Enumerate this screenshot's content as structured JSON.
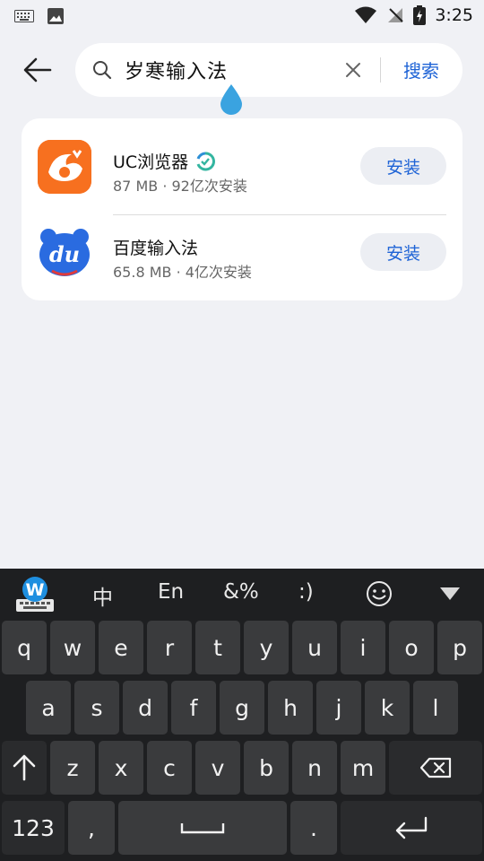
{
  "status": {
    "time": "3:25"
  },
  "search": {
    "query": "岁寒输入法",
    "button": "搜索"
  },
  "apps": [
    {
      "name": "UC浏览器",
      "meta": "87 MB · 92亿次安装",
      "action": "安装",
      "icon": "uc-browser-icon",
      "badge": "verified-badge-icon"
    },
    {
      "name": "百度输入法",
      "meta": "65.8 MB · 4亿次安装",
      "action": "安装",
      "icon": "baidu-ime-icon"
    }
  ],
  "keyboard": {
    "toolbar": [
      "中",
      "En",
      "&%",
      ":)"
    ],
    "row1": [
      "q",
      "w",
      "e",
      "r",
      "t",
      "y",
      "u",
      "i",
      "o",
      "p"
    ],
    "row2": [
      "a",
      "s",
      "d",
      "f",
      "g",
      "h",
      "j",
      "k",
      "l"
    ],
    "row3": [
      "z",
      "x",
      "c",
      "v",
      "b",
      "n",
      "m"
    ],
    "numbers": "123",
    "comma": ",",
    "period": "."
  },
  "colors": {
    "accent": "#1e63d6",
    "background": "#f0f1f5",
    "keyboard": "#1e1f21"
  }
}
